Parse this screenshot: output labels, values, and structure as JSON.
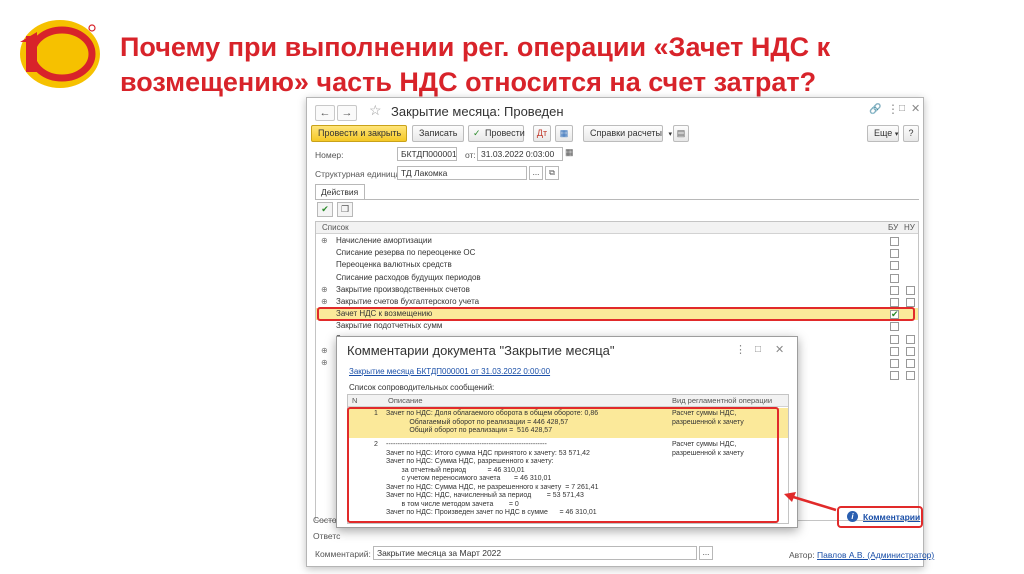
{
  "slide": {
    "title": "Почему при выполнении рег. операции «Зачет НДС к возмещению» часть НДС относится на  счет затрат?",
    "logo_text": "1С",
    "accent": "#d8232a"
  },
  "window": {
    "title": "Закрытие месяца: Проведен",
    "nav_back": "←",
    "nav_forward": "→",
    "star": "☆",
    "toolbar": {
      "post_close": "Провести и закрыть",
      "save": "Записать",
      "post": "Провести",
      "reports": "Справки расчеты",
      "more": "Еще",
      "help": "?"
    },
    "number_label": "Номер:",
    "number_value": "БКТДП000001",
    "date_label": "от:",
    "date_value": "31.03.2022  0:03:00",
    "unit_label": "Структурная единица:",
    "unit_value": "ТД Лакомка",
    "tab_actions": "Действия",
    "list": {
      "col_list": "Список",
      "col_bu": "БУ",
      "col_nu": "НУ",
      "rows": [
        {
          "label": "Начисление амортизации",
          "exp": "⊕"
        },
        {
          "label": "Списание резерва по переоценке ОС",
          "exp": ""
        },
        {
          "label": "Переоценка валютных средств",
          "exp": ""
        },
        {
          "label": "Списание расходов будущих периодов",
          "exp": ""
        },
        {
          "label": "Закрытие производственных счетов",
          "exp": "⊕"
        },
        {
          "label": "Закрытие счетов бухгалтерского учета",
          "exp": "⊕"
        },
        {
          "label": "Зачет НДС к возмещению",
          "exp": ""
        },
        {
          "label": "Закрытие подотчетных сумм",
          "exp": ""
        },
        {
          "label": "З",
          "exp": ""
        },
        {
          "label": "Р",
          "exp": "⊕"
        },
        {
          "label": "Р",
          "exp": "⊕"
        },
        {
          "label": "З",
          "exp": ""
        }
      ]
    },
    "status_label": "Состоя",
    "resp_label": "Ответс",
    "comment_label": "Комментарий:",
    "comment_value": "Закрытие месяца за Март 2022",
    "author_label": "Автор:",
    "author_value": "Павлов А.В. (Администратор)",
    "comments_link": "Комментарии"
  },
  "dialog": {
    "title": "Комментарии документа \"Закрытие месяца\"",
    "link": "Закрытие месяца БКТДП000001 от 31.03.2022 0:00:00",
    "list_label": "Список сопроводительных сообщений:",
    "col_n": "N",
    "col_desc": "Описание",
    "col_op": "Вид регламентной операции",
    "rows": [
      {
        "n": "1",
        "desc": "Зачет по НДС: Доля облагаемого оборота в общем обороте: 0,86\n            Облагаемый оборот по реализации = 446 428,57\n            Общий оборот по реализации =  516 428,57",
        "op": "Расчет суммы НДС,\nразрешенной к зачету"
      },
      {
        "n": "2",
        "desc": "---------------------------------------------------------------------\nЗачет по НДС: Итого сумма НДС принятого к зачету: 53 571,42\nЗачет по НДС: Сумма НДС, разрешенного к зачету:\n        за отчетный период           = 46 310,01\n        с учетом переносимого зачета       = 46 310,01\nЗачет по НДС: Сумма НДС, не разрешенного к зачету  = 7 261,41\nЗачет по НДС: НДС, начисленный за период        = 53 571,43\n        в том числе методом зачета        = 0\nЗачет по НДС: Произведен зачет по НДС в сумме      = 46 310,01",
        "op": "Расчет суммы НДС,\nразрешенной к зачету"
      }
    ]
  }
}
